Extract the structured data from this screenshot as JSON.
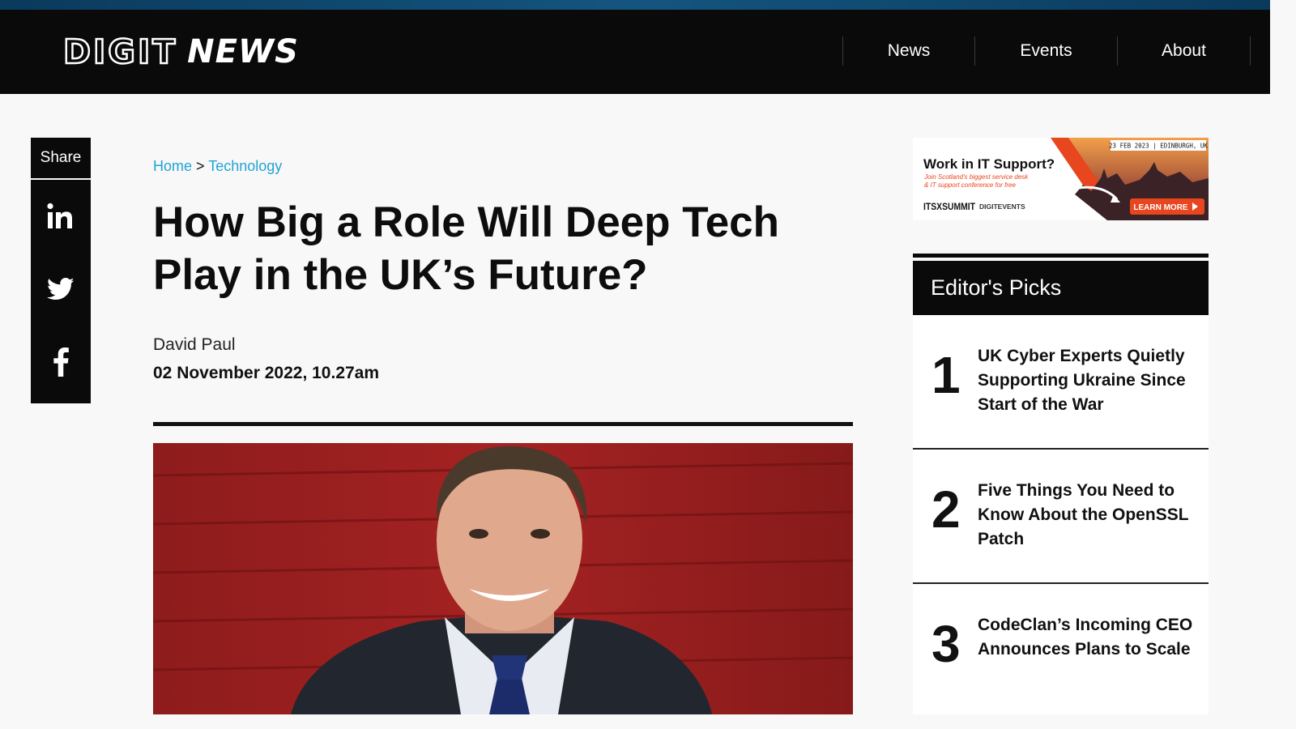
{
  "header": {
    "logo_digit": "DIGIT",
    "logo_news": "NEWS",
    "nav": [
      {
        "label": "News"
      },
      {
        "label": "Events"
      },
      {
        "label": "About"
      }
    ]
  },
  "share": {
    "label": "Share",
    "buttons": [
      "linkedin-icon",
      "twitter-icon",
      "facebook-icon"
    ]
  },
  "article": {
    "breadcrumb": {
      "home": "Home",
      "separator": ">",
      "section": "Technology"
    },
    "title": "How Big a Role Will Deep Tech Play in the UK’s Future?",
    "author": "David Paul",
    "date": "02 November 2022",
    "time": "10.27am"
  },
  "ad": {
    "headline": "Work in IT Support?",
    "subline1": "Join Scotland's biggest service desk",
    "subline2": "& IT support conference for free",
    "date_location": "23 FEB 2023 | EDINBURGH, UK",
    "brand1": "ITSXSUMMIT",
    "brand2": "DIGITEVENTS",
    "cta": "LEARN MORE"
  },
  "editors_picks": {
    "heading": "Editor's Picks",
    "items": [
      {
        "num": "1",
        "title": "UK Cyber Experts Quietly Supporting Ukraine Since Start of the War"
      },
      {
        "num": "2",
        "title": "Five Things You Need to Know About the OpenSSL Patch"
      },
      {
        "num": "3",
        "title": "CodeClan’s Incoming CEO Announces Plans to Scale"
      }
    ]
  },
  "colors": {
    "header_bg": "#0a0a0a",
    "link": "#21a3d6",
    "page_bg": "#f8f8f8",
    "ad_accent": "#e8461f"
  }
}
